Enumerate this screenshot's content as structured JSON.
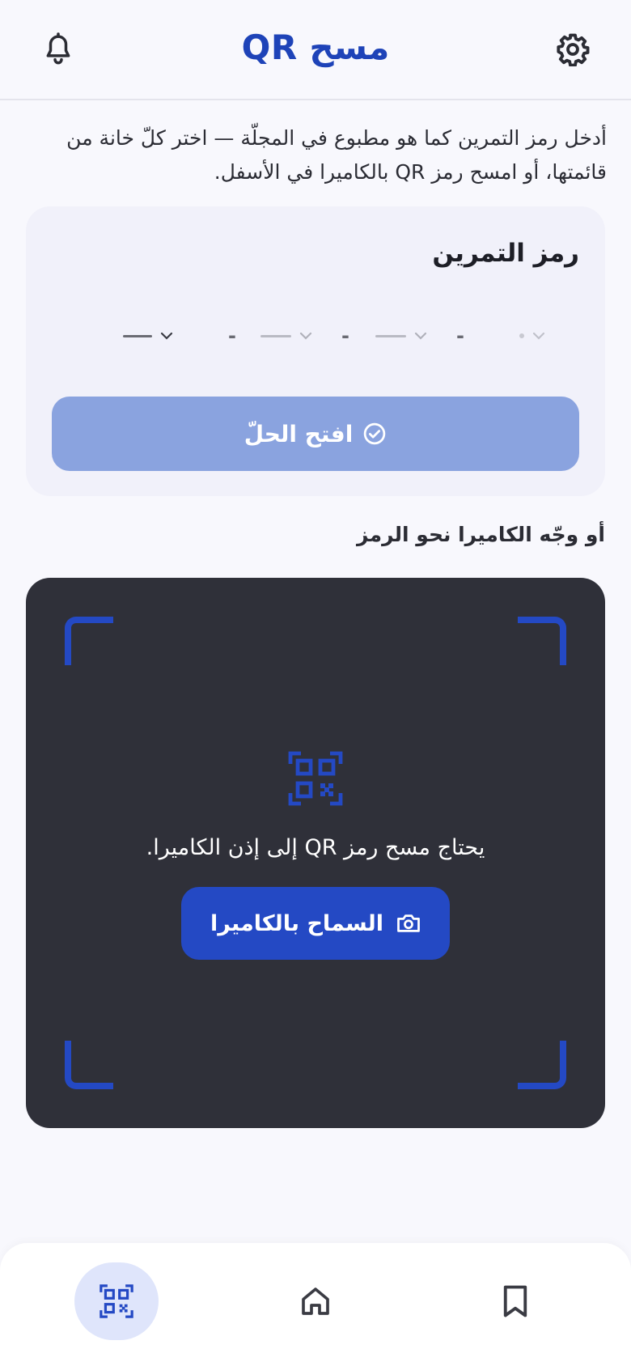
{
  "header": {
    "title": "مسح QR",
    "icons": {
      "left": "bell-icon",
      "right": "gear-icon"
    }
  },
  "intro_text": "أدخل رمز التمرين كما هو مطبوع في المجلّة — اختر كلّ خانة من قائمتها، أو امسح رمز QR بالكاميرا في الأسفل.",
  "code_card": {
    "title": "رمز التمرين",
    "separator": "-",
    "slots": [
      {
        "name": "slot-1",
        "value": ""
      },
      {
        "name": "slot-2",
        "value": ""
      },
      {
        "name": "slot-3",
        "value": ""
      },
      {
        "name": "slot-4",
        "value": ""
      }
    ],
    "open_button": {
      "label": "افتح الحلّ",
      "icon": "check-circle-icon"
    }
  },
  "camera_section": {
    "label": "أو وجّه الكاميرا نحو الرمز",
    "icon": "qr-code-icon",
    "message": "يحتاج مسح رمز QR إلى إذن الكاميرا.",
    "allow_button": {
      "label": "السماح بالكاميرا",
      "icon": "camera-icon"
    }
  },
  "bottom_nav": {
    "items": [
      {
        "name": "qr-scan",
        "icon": "qr-code-icon",
        "active": true
      },
      {
        "name": "home",
        "icon": "home-icon",
        "active": false
      },
      {
        "name": "saved",
        "icon": "bookmark-icon",
        "active": false
      }
    ]
  },
  "colors": {
    "primary": "#2449c4",
    "title": "#1e43b8",
    "button_disabled": "#8aa3df",
    "camera_bg": "#2f3039",
    "card_bg": "#f1f1fa",
    "nav_active_bg": "#dfe5fb"
  }
}
